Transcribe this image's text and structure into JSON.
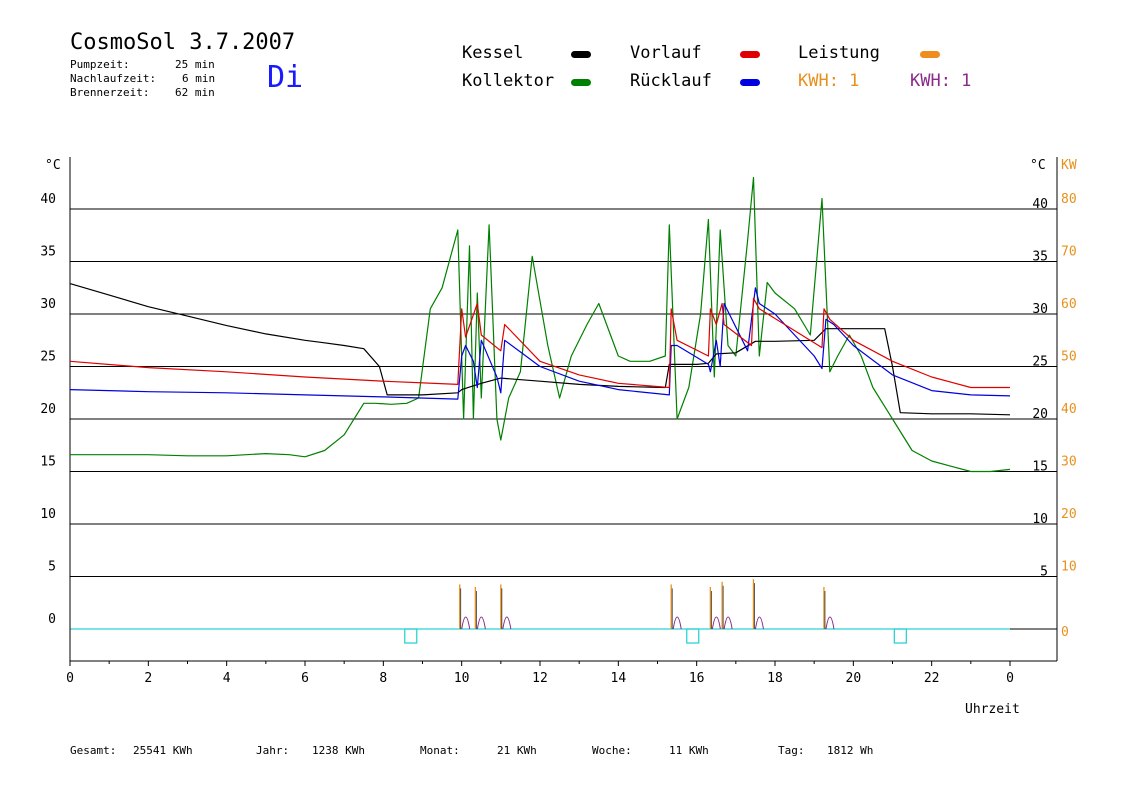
{
  "header": {
    "title": "CosmoSol 3.7.2007",
    "day": "Di",
    "stats": [
      {
        "label": "Pumpzeit:",
        "value": "25 min"
      },
      {
        "label": "Nachlaufzeit:",
        "value": "6 min"
      },
      {
        "label": "Brennerzeit:",
        "value": "62 min"
      }
    ]
  },
  "legend": {
    "kessel": {
      "label": "Kessel",
      "color": "#000000"
    },
    "vorlauf": {
      "label": "Vorlauf",
      "color": "#e00000"
    },
    "leistung": {
      "label": "Leistung",
      "color": "#f08c1e"
    },
    "kollektor": {
      "label": "Kollektor",
      "color": "#008000"
    },
    "ruecklauf": {
      "label": "Rücklauf",
      "color": "#0000e0"
    },
    "kwh1": {
      "label": "KWH: 1",
      "color": "#e8901e"
    },
    "kwh2": {
      "label": "KWH: 1",
      "color": "#8a2a8a"
    }
  },
  "axes": {
    "left_unit": "°C",
    "right_unit_c": "°C",
    "right_unit_kw": "KW",
    "x_label": "Uhrzeit"
  },
  "footer": {
    "gesamt_label": "Gesamt:",
    "gesamt_value": "25541 KWh",
    "jahr_label": "Jahr:",
    "jahr_value": "1238 KWh",
    "monat_label": "Monat:",
    "monat_value": "21 KWh",
    "woche_label": "Woche:",
    "woche_value": "11 KWh",
    "tag_label": "Tag:",
    "tag_value": "1812 Wh"
  },
  "chart_data": {
    "type": "line",
    "xlim": [
      0,
      24
    ],
    "ylim": [
      -3,
      45
    ],
    "y2_kw_ylim": [
      -6,
      90
    ],
    "grid": true,
    "x_ticks": [
      "0",
      "2",
      "4",
      "6",
      "8",
      "10",
      "12",
      "14",
      "16",
      "18",
      "20",
      "22",
      "0"
    ],
    "y_ticks_left": [
      "0",
      "5",
      "10",
      "15",
      "20",
      "25",
      "30",
      "35",
      "40"
    ],
    "y_ticks_right_c": [
      "5",
      "10",
      "15",
      "20",
      "25",
      "30",
      "35",
      "40"
    ],
    "y_ticks_right_kw": [
      "0",
      "10",
      "20",
      "30",
      "40",
      "50",
      "60",
      "70",
      "80"
    ],
    "series": [
      {
        "name": "Kessel",
        "color": "#000000",
        "x": [
          0,
          1,
          2,
          3,
          4,
          5,
          6,
          6.4,
          7,
          7.5,
          7.9,
          8.1,
          8.5,
          9,
          9.9,
          10,
          10.5,
          11,
          12,
          13,
          14,
          15.2,
          15.3,
          16,
          16.3,
          16.5,
          17,
          17.5,
          18,
          19,
          19.3,
          20,
          20.8,
          21.0,
          21.2,
          22,
          23,
          24
        ],
        "y": [
          32.9,
          31.8,
          30.7,
          29.8,
          28.9,
          28.1,
          27.5,
          27.3,
          27,
          26.7,
          25,
          22.3,
          22.3,
          22.3,
          22.5,
          22.8,
          23.4,
          23.9,
          23.6,
          23.3,
          23.1,
          23.0,
          25.2,
          25.2,
          25.3,
          26.2,
          26.3,
          27.4,
          27.4,
          27.5,
          28.6,
          28.6,
          28.6,
          25,
          20.6,
          20.5,
          20.5,
          20.4
        ]
      },
      {
        "name": "Vorlauf",
        "color": "#e00000",
        "x": [
          0,
          2,
          4,
          6,
          8,
          9.9,
          10.0,
          10.1,
          10.4,
          10.5,
          11,
          11.1,
          12,
          13,
          14,
          15.3,
          15.35,
          15.5,
          16.3,
          16.35,
          16.5,
          16.65,
          16.7,
          17.4,
          17.45,
          17.6,
          19.2,
          19.25,
          19.4,
          20,
          21,
          22,
          23,
          24
        ],
        "y": [
          25.5,
          24.9,
          24.5,
          24.0,
          23.6,
          23.3,
          30.5,
          27.8,
          31.0,
          28.0,
          26.5,
          29.0,
          25.5,
          24.2,
          23.4,
          23.0,
          30.5,
          27.5,
          26.0,
          30.5,
          29.0,
          31.0,
          29.0,
          27.0,
          31.5,
          30.5,
          26.8,
          30.5,
          29.5,
          27.5,
          25.5,
          24.0,
          23.0,
          23.0
        ]
      },
      {
        "name": "Rücklauf",
        "color": "#0000e0",
        "x": [
          0,
          2,
          4,
          6,
          8,
          9.9,
          10.0,
          10.1,
          10.3,
          10.4,
          10.5,
          10.9,
          11.0,
          11.1,
          12,
          13,
          14,
          15.3,
          15.35,
          15.5,
          16.3,
          16.35,
          16.5,
          16.6,
          16.7,
          17.3,
          17.5,
          17.6,
          18,
          19,
          19.2,
          19.3,
          19.5,
          20,
          21,
          22,
          23,
          24
        ],
        "y": [
          22.8,
          22.6,
          22.5,
          22.3,
          22.1,
          21.9,
          26.0,
          27.0,
          25.5,
          23.0,
          27.5,
          24.0,
          22.5,
          27.5,
          25.0,
          23.6,
          22.8,
          22.3,
          27.0,
          27.0,
          25.2,
          24.5,
          27.5,
          25.0,
          31.0,
          26.5,
          32.5,
          31.0,
          30.0,
          26.0,
          24.8,
          29.5,
          29.0,
          27.0,
          24.2,
          22.7,
          22.3,
          22.2
        ]
      },
      {
        "name": "Kollektor",
        "color": "#008000",
        "x": [
          0,
          1,
          2,
          3,
          4,
          5,
          5.6,
          6,
          6.5,
          7,
          7.5,
          7.8,
          8.2,
          8.6,
          8.9,
          9.2,
          9.5,
          9.9,
          10.05,
          10.2,
          10.3,
          10.4,
          10.5,
          10.7,
          10.9,
          11.0,
          11.2,
          11.5,
          11.8,
          12.2,
          12.5,
          12.8,
          13.2,
          13.5,
          13.8,
          14.0,
          14.3,
          14.8,
          15.2,
          15.3,
          15.5,
          15.8,
          16.1,
          16.3,
          16.45,
          16.6,
          16.8,
          17.0,
          17.3,
          17.45,
          17.6,
          17.8,
          18.0,
          18.5,
          18.9,
          19.2,
          19.4,
          19.6,
          19.9,
          20.2,
          20.5,
          21.0,
          21.5,
          22.0,
          22.5,
          23.0,
          23.5,
          24
        ],
        "y": [
          16.6,
          16.6,
          16.6,
          16.5,
          16.5,
          16.7,
          16.6,
          16.4,
          17.0,
          18.5,
          21.5,
          21.5,
          21.4,
          21.5,
          22.0,
          30.5,
          32.5,
          38.0,
          20.0,
          36.5,
          20.0,
          32.0,
          22.0,
          38.5,
          20.0,
          18.0,
          22.0,
          24.5,
          35.5,
          27.0,
          22.0,
          26.0,
          29.0,
          31.0,
          28.0,
          26.0,
          25.5,
          25.5,
          26.0,
          38.5,
          20.0,
          23.0,
          30.0,
          39.0,
          24.0,
          38.0,
          27.0,
          26.0,
          37.0,
          43.0,
          26.0,
          33.0,
          32.0,
          30.5,
          28.0,
          41.0,
          24.5,
          26.0,
          28.0,
          26.0,
          23.0,
          20.0,
          17.0,
          16.0,
          15.5,
          15.0,
          15.0,
          15.2
        ]
      }
    ],
    "power_peaks_kw": [
      {
        "x": 9.95,
        "kw": 8.5
      },
      {
        "x": 10.35,
        "kw": 8.0
      },
      {
        "x": 11.0,
        "kw": 8.5
      },
      {
        "x": 15.35,
        "kw": 8.5
      },
      {
        "x": 16.35,
        "kw": 8.0
      },
      {
        "x": 16.65,
        "kw": 9.0
      },
      {
        "x": 17.45,
        "kw": 9.5
      },
      {
        "x": 19.25,
        "kw": 8.0
      }
    ],
    "burner_markers_x": [
      8.7,
      15.9,
      21.2
    ]
  }
}
